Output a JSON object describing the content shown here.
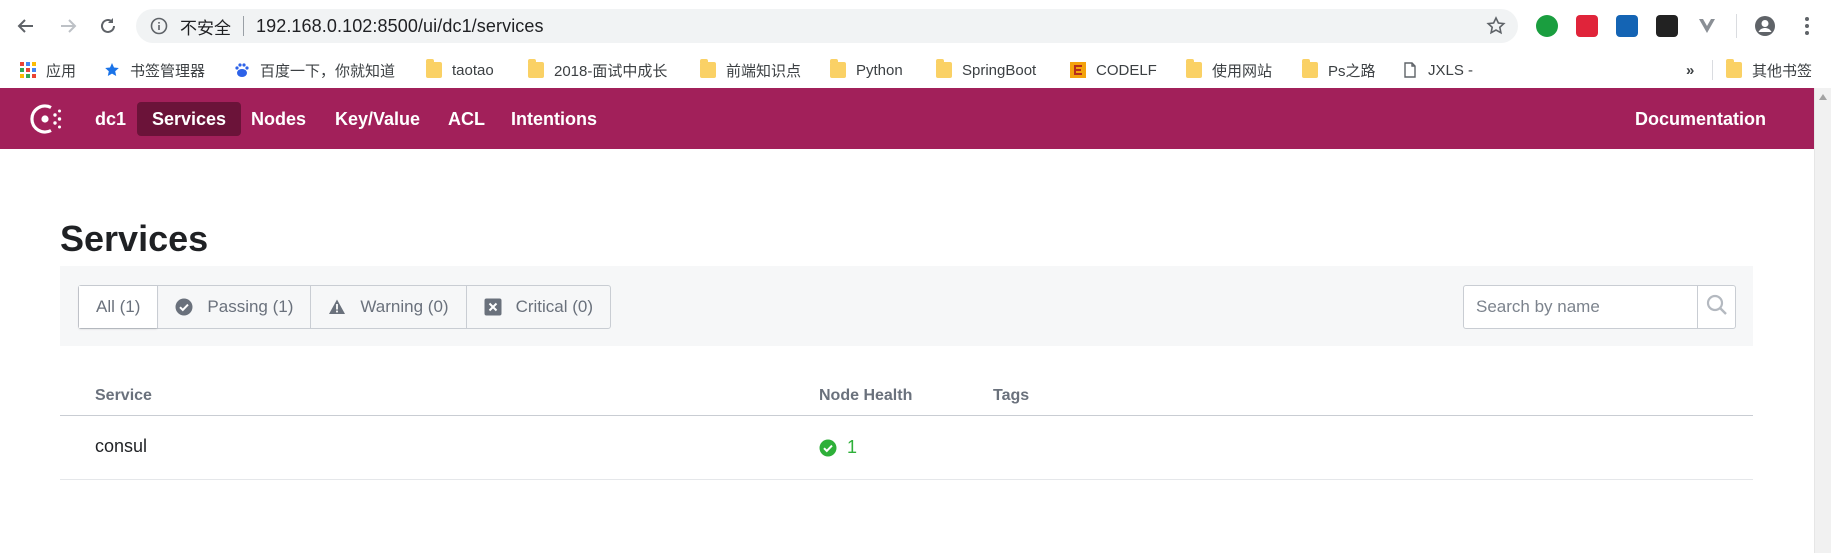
{
  "browser": {
    "insecure_label": "不安全",
    "url": "192.168.0.102:8500/ui/dc1/services",
    "icons": [
      "back-icon",
      "forward-icon",
      "reload-icon",
      "info-icon",
      "bookmark-star-icon",
      "account-icon",
      "menu-icon"
    ]
  },
  "bookmarks": {
    "items": [
      {
        "label": "应用",
        "icon": "apps-grid-icon"
      },
      {
        "label": "书签管理器",
        "icon": "star-icon"
      },
      {
        "label": "百度一下，你就知道",
        "icon": "baidu-icon"
      },
      {
        "label": "taotao",
        "icon": "folder-icon"
      },
      {
        "label": "2018-面试中成长",
        "icon": "folder-icon"
      },
      {
        "label": "前端知识点",
        "icon": "folder-icon"
      },
      {
        "label": "Python",
        "icon": "folder-icon"
      },
      {
        "label": "SpringBoot",
        "icon": "folder-icon"
      },
      {
        "label": "CODELF",
        "icon": "codelf-icon"
      },
      {
        "label": "使用网站",
        "icon": "folder-icon"
      },
      {
        "label": "Ps之路",
        "icon": "folder-icon"
      },
      {
        "label": "JXLS -",
        "icon": "page-icon"
      }
    ],
    "overflow": "»",
    "other": "其他书签"
  },
  "header": {
    "datacenter": "dc1",
    "nav": [
      {
        "label": "Services",
        "active": true
      },
      {
        "label": "Nodes",
        "active": false
      },
      {
        "label": "Key/Value",
        "active": false
      },
      {
        "label": "ACL",
        "active": false
      },
      {
        "label": "Intentions",
        "active": false
      }
    ],
    "documentation": "Documentation"
  },
  "page": {
    "title": "Services",
    "filters": [
      {
        "label": "All (1)",
        "icon": ""
      },
      {
        "label": "Passing (1)",
        "icon": "check-circle-icon"
      },
      {
        "label": "Warning (0)",
        "icon": "warning-icon"
      },
      {
        "label": "Critical (0)",
        "icon": "critical-x-icon"
      }
    ],
    "search_placeholder": "Search by name"
  },
  "table": {
    "columns": [
      "Service",
      "Node Health",
      "Tags"
    ],
    "rows": [
      {
        "service": "consul",
        "node_health": "1",
        "tags": ""
      }
    ]
  },
  "colors": {
    "brand": "#a2205a",
    "brand_active": "#6b1339",
    "passing": "#2eb039"
  }
}
